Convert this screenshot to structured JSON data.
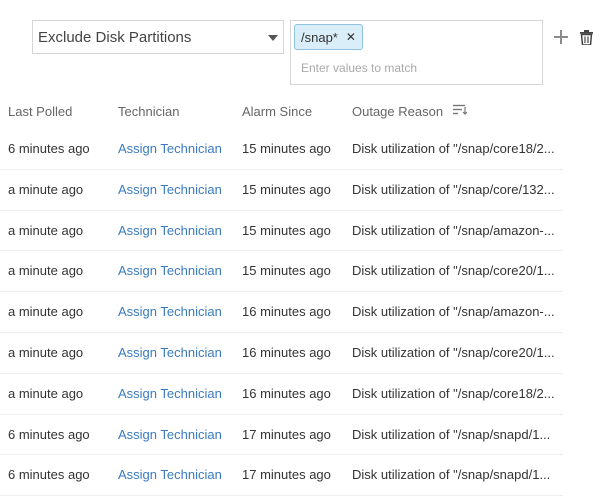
{
  "filter": {
    "selected": "Exclude Disk Partitions",
    "chips": [
      "/snap*"
    ],
    "placeholder": "Enter values to match"
  },
  "icons": {
    "add": "add-icon",
    "delete": "trash-icon",
    "sort": "sort-icon",
    "dropdown": "caret-down-icon",
    "chip_remove": "close-icon"
  },
  "colors": {
    "link": "#3a7bbf",
    "chip_bg": "#d9eef8",
    "chip_border": "#8ec2df"
  },
  "table": {
    "headers": [
      "Last Polled",
      "Technician",
      "Alarm Since",
      "Outage Reason"
    ],
    "rows": [
      {
        "last_polled": "6 minutes ago",
        "technician": "Assign Technician",
        "alarm_since": "15 minutes ago",
        "outage_reason": "Disk utilization of \"/snap/core18/2..."
      },
      {
        "last_polled": "a minute ago",
        "technician": "Assign Technician",
        "alarm_since": "15 minutes ago",
        "outage_reason": "Disk utilization of \"/snap/core/132..."
      },
      {
        "last_polled": "a minute ago",
        "technician": "Assign Technician",
        "alarm_since": "15 minutes ago",
        "outage_reason": "Disk utilization of \"/snap/amazon-..."
      },
      {
        "last_polled": "a minute ago",
        "technician": "Assign Technician",
        "alarm_since": "15 minutes ago",
        "outage_reason": "Disk utilization of \"/snap/core20/1..."
      },
      {
        "last_polled": "a minute ago",
        "technician": "Assign Technician",
        "alarm_since": "16 minutes ago",
        "outage_reason": "Disk utilization of \"/snap/amazon-..."
      },
      {
        "last_polled": "a minute ago",
        "technician": "Assign Technician",
        "alarm_since": "16 minutes ago",
        "outage_reason": "Disk utilization of \"/snap/core20/1..."
      },
      {
        "last_polled": "a minute ago",
        "technician": "Assign Technician",
        "alarm_since": "16 minutes ago",
        "outage_reason": "Disk utilization of \"/snap/core18/2..."
      },
      {
        "last_polled": "6 minutes ago",
        "technician": "Assign Technician",
        "alarm_since": "17 minutes ago",
        "outage_reason": "Disk utilization of \"/snap/snapd/1..."
      },
      {
        "last_polled": "6 minutes ago",
        "technician": "Assign Technician",
        "alarm_since": "17 minutes ago",
        "outage_reason": "Disk utilization of \"/snap/snapd/1..."
      }
    ]
  }
}
